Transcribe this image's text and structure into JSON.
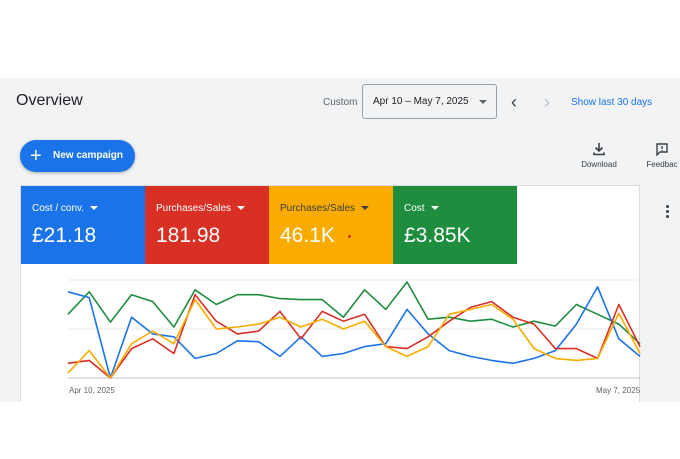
{
  "header": {
    "title": "Overview",
    "custom_label": "Custom",
    "date_range": "Apr 10 – May 7, 2025",
    "prev_icon": "chevron-left-icon",
    "next_icon": "chevron-right-icon",
    "show_last": "Show last 30 days"
  },
  "actions": {
    "new_campaign": "New campaign",
    "download": "Download",
    "feedback": "Feedbac"
  },
  "metrics": [
    {
      "label": "Cost / conv.",
      "value": "£21.18",
      "color": "#1a73e8"
    },
    {
      "label": "Purchases/Sales",
      "value": "181.98",
      "color": "#d93025"
    },
    {
      "label": "Purchases/Sales",
      "value": "46.1K",
      "color": "#f9ab00"
    },
    {
      "label": "Cost",
      "value": "£3.85K",
      "color": "#1e8e3e"
    }
  ],
  "chart_data": {
    "type": "line",
    "x": [
      "Apr 10, 2025",
      "",
      "",
      "",
      "",
      "",
      "",
      "",
      "",
      "",
      "",
      "",
      "",
      "",
      "",
      "",
      "",
      "",
      "",
      "",
      "",
      "",
      "",
      "",
      "",
      "",
      "",
      "May 7, 2025"
    ],
    "x_tick_labels": [
      "Apr 10, 2025",
      "May 7, 2025"
    ],
    "y_scale": "relative 0–100 (no axis labels shown)",
    "ylim": [
      0,
      100
    ],
    "grid": true,
    "series": [
      {
        "color": "#1a73e8",
        "values": [
          88,
          82,
          0,
          62,
          45,
          42,
          20,
          25,
          38,
          37,
          22,
          42,
          22,
          25,
          32,
          35,
          70,
          45,
          28,
          22,
          18,
          15,
          20,
          28,
          55,
          93,
          40,
          22
        ]
      },
      {
        "color": "#d93025",
        "values": [
          15,
          18,
          0,
          30,
          40,
          25,
          85,
          58,
          45,
          48,
          68,
          40,
          68,
          58,
          65,
          32,
          30,
          42,
          58,
          72,
          78,
          62,
          55,
          30,
          30,
          20,
          75,
          32
        ]
      },
      {
        "color": "#f9ab00",
        "values": [
          5,
          28,
          0,
          35,
          48,
          35,
          80,
          50,
          52,
          55,
          62,
          52,
          60,
          50,
          58,
          32,
          22,
          32,
          65,
          70,
          75,
          60,
          30,
          20,
          18,
          20,
          66,
          25
        ]
      },
      {
        "color": "#1e8e3e",
        "values": [
          65,
          88,
          57,
          85,
          78,
          52,
          90,
          75,
          85,
          85,
          81,
          80,
          80,
          62,
          90,
          70,
          98,
          60,
          62,
          58,
          60,
          52,
          58,
          53,
          75,
          65,
          55,
          35
        ]
      }
    ]
  }
}
